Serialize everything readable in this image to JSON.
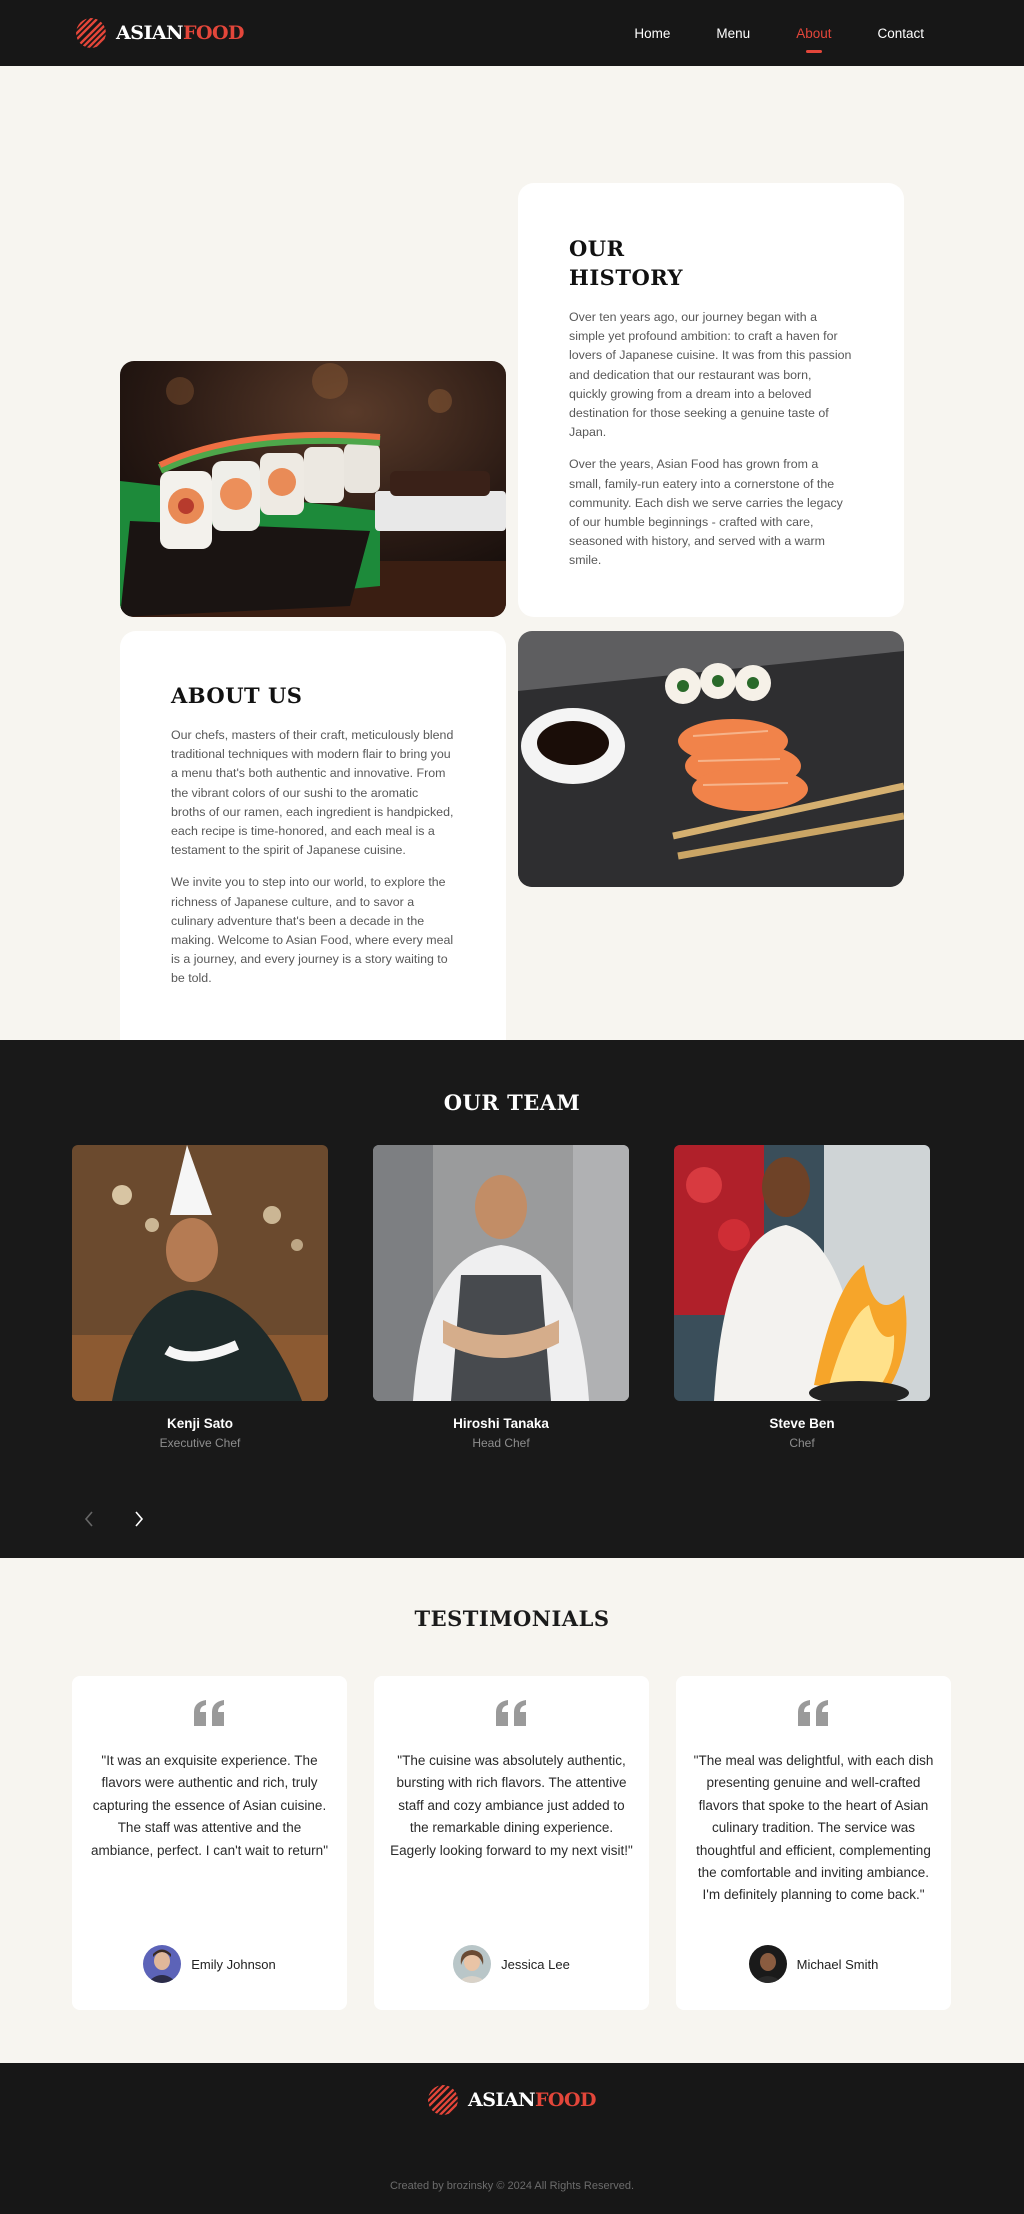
{
  "brand": {
    "name_part1": "ASIAN",
    "name_part2": "FOOD",
    "accent": "#e3463a"
  },
  "nav": {
    "items": [
      {
        "label": "Home",
        "active": false
      },
      {
        "label": "Menu",
        "active": false
      },
      {
        "label": "About",
        "active": true
      },
      {
        "label": "Contact",
        "active": false
      }
    ]
  },
  "history": {
    "title_line1": "OUR",
    "title_line2": "HISTORY",
    "paragraphs": [
      "Over ten years ago, our journey began with a simple yet profound ambition: to craft a haven for lovers of Japanese cuisine. It was from this passion and dedication that our restaurant was born, quickly growing from a dream into a beloved destination for those seeking a genuine taste of Japan.",
      "Over the years, Asian Food has grown from a small, family-run eatery into a cornerstone of the community. Each dish we serve carries the legacy of our humble beginnings - crafted with care, seasoned with history, and served with a warm smile."
    ]
  },
  "about": {
    "title": "ABOUT US",
    "paragraphs": [
      "Our chefs, masters of their craft, meticulously blend traditional techniques with modern flair to bring you a menu that's both authentic and innovative. From the vibrant colors of our sushi to the aromatic broths of our ramen, each ingredient is handpicked, each recipe is time-honored, and each meal is a testament to the spirit of Japanese cuisine.",
      "We invite you to step into our world, to explore the richness of Japanese culture, and to savor a culinary adventure that's been a decade in the making. Welcome to Asian Food, where every meal is a journey, and every journey is a story waiting to be told."
    ]
  },
  "team": {
    "title": "OUR TEAM",
    "members": [
      {
        "name": "Kenji Sato",
        "role": "Executive Chef"
      },
      {
        "name": "Hiroshi Tanaka",
        "role": "Head Chef"
      },
      {
        "name": "Steve Ben",
        "role": "Chef"
      }
    ]
  },
  "testimonials": {
    "title": "TESTIMONIALS",
    "items": [
      {
        "quote": "\"It was an exquisite experience. The flavors were authentic and rich, truly capturing the essence of Asian cuisine. The staff was attentive and the ambiance, perfect. I can't wait to return\"",
        "author": "Emily Johnson"
      },
      {
        "quote": "\"The cuisine was absolutely authentic, bursting with rich flavors. The attentive staff and cozy ambiance just added to the remarkable dining experience. Eagerly looking forward to my next visit!\"",
        "author": "Jessica Lee"
      },
      {
        "quote": "\"The meal was delightful, with each dish presenting genuine and well-crafted flavors that spoke to the heart of Asian culinary tradition. The service was thoughtful and efficient, complementing the comfortable and inviting ambiance. I'm definitely planning to come back.\"",
        "author": "Michael Smith"
      }
    ]
  },
  "footer": {
    "copyright": "Created by brozinsky © 2024 All Rights Reserved."
  }
}
